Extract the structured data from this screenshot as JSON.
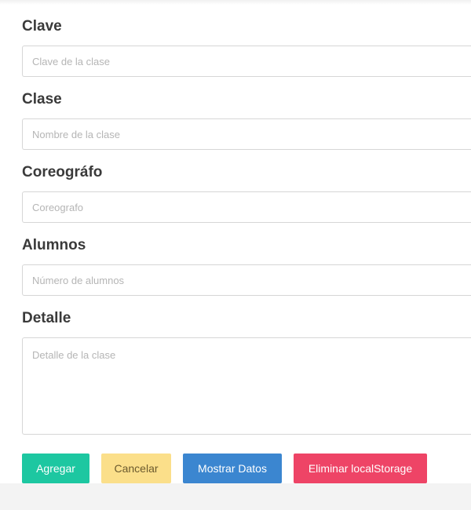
{
  "form": {
    "fields": [
      {
        "label": "Clave",
        "placeholder": "Clave de la clase"
      },
      {
        "label": "Clase",
        "placeholder": "Nombre de la clase"
      },
      {
        "label": "Coreográfo",
        "placeholder": "Coreografo"
      },
      {
        "label": "Alumnos",
        "placeholder": "Número de alumnos"
      }
    ],
    "detalle": {
      "label": "Detalle",
      "placeholder": "Detalle de la clase"
    }
  },
  "buttons": {
    "agregar": "Agregar",
    "cancelar": "Cancelar",
    "mostrar": "Mostrar Datos",
    "eliminar": "Eliminar localStorage"
  },
  "colors": {
    "agregar": "#1dc7a1",
    "cancelar": "#fbdf8a",
    "mostrar": "#3b86d0",
    "eliminar": "#ee4466"
  }
}
